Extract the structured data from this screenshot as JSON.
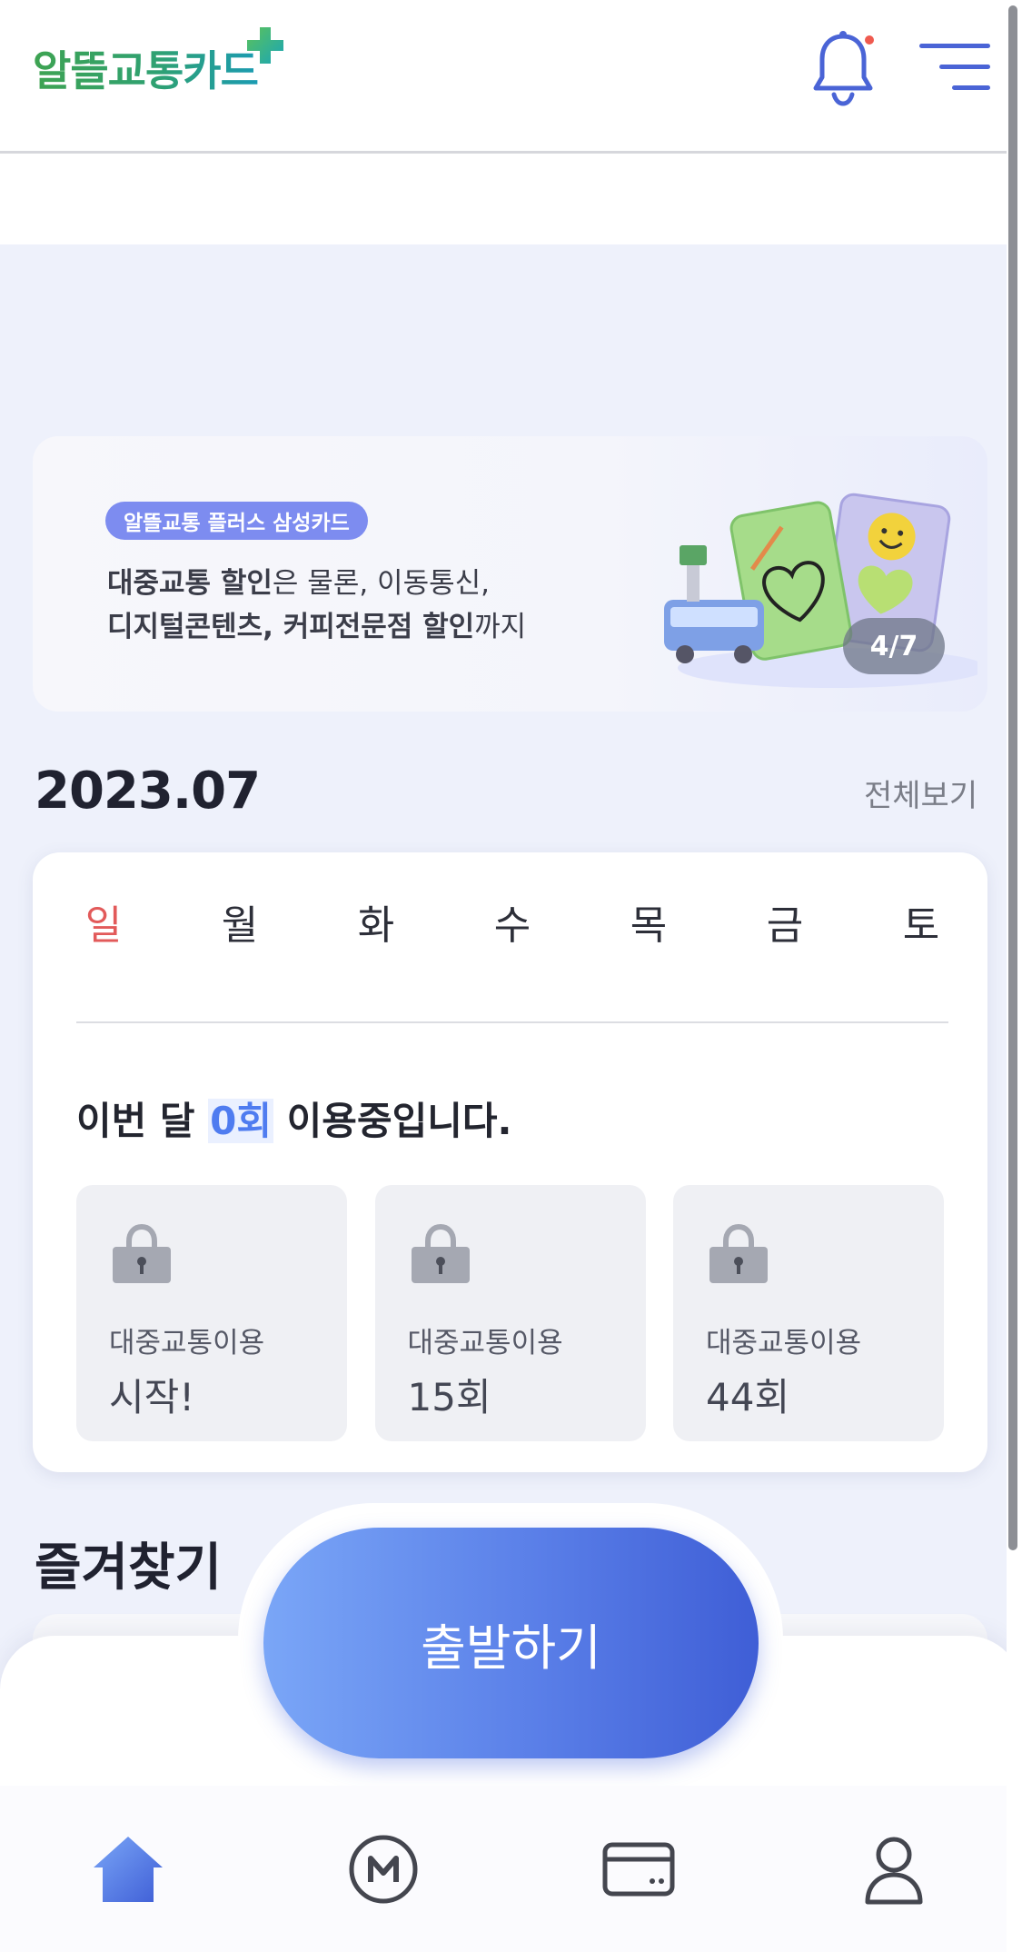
{
  "header": {
    "logo_text": "알뜰교통카드",
    "logo_plus": "+",
    "bell_icon": "bell-icon",
    "menu_icon": "hamburger-menu-icon",
    "has_notification_dot": true
  },
  "banner": {
    "tag": "알뜰교통 플러스 삼성카드",
    "line1_bold": "대중교통 할인",
    "line1_rest": "은 물론, 이동통신,",
    "line2_bold": "디지털콘텐츠, 커피전문점 할인",
    "line2_rest": "까지",
    "counter": "4/7"
  },
  "calendar": {
    "month": "2023.07",
    "view_all": "전체보기",
    "weekdays": [
      "일",
      "월",
      "화",
      "수",
      "목",
      "금",
      "토"
    ],
    "usage_prefix": "이번 달 ",
    "usage_count": "0회",
    "usage_suffix": " 이용중입니다."
  },
  "milestones": [
    {
      "label": "대중교통이용",
      "value": "시작!",
      "icon": "lock-icon"
    },
    {
      "label": "대중교통이용",
      "value": "15회",
      "icon": "lock-icon"
    },
    {
      "label": "대중교통이용",
      "value": "44회",
      "icon": "lock-icon"
    }
  ],
  "favorites": {
    "title": "즐겨찾기"
  },
  "depart_button": "출발하기",
  "tabs": [
    {
      "name": "home",
      "icon": "home-icon",
      "active": true
    },
    {
      "name": "mileage",
      "icon": "mileage-m-icon",
      "active": false
    },
    {
      "name": "card",
      "icon": "card-icon",
      "active": false
    },
    {
      "name": "my",
      "icon": "person-icon",
      "active": false
    }
  ],
  "colors": {
    "accent": "#4f7cf0",
    "sunday": "#e25a5a",
    "background": "#eef1fb"
  }
}
